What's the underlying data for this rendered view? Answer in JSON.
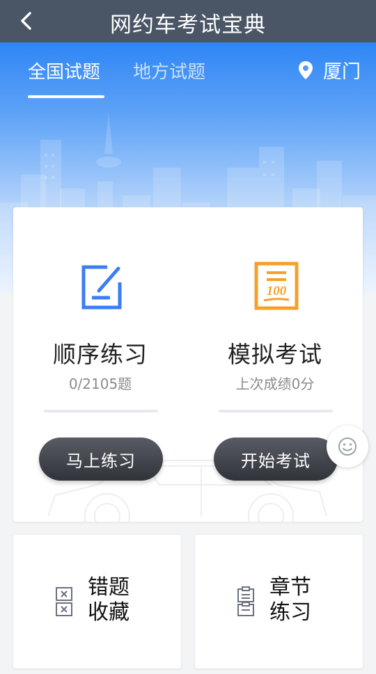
{
  "header": {
    "title": "网约车考试宝典",
    "back_icon": "chevron-left-icon"
  },
  "tabs": [
    {
      "label": "全国试题",
      "active": true
    },
    {
      "label": "地方试题",
      "active": false
    }
  ],
  "location": {
    "city": "厦门",
    "icon": "location-pin-icon"
  },
  "practice": {
    "label": "顺序练习",
    "progress": "0/2105题",
    "button": "马上练习",
    "icon": "edit-note-icon",
    "color": "#3a7df6"
  },
  "exam": {
    "label": "模拟考试",
    "last_score": "上次成绩0分",
    "button": "开始考试",
    "icon": "score-100-icon",
    "color": "#f5a02a"
  },
  "wrong_collect": {
    "line1": "错题",
    "line2": "收藏",
    "icon": "wrong-questions-icon"
  },
  "chapter": {
    "line1": "章节",
    "line2": "练习",
    "icon": "clipboard-icon"
  },
  "feedback_icon": "smiley-icon"
}
